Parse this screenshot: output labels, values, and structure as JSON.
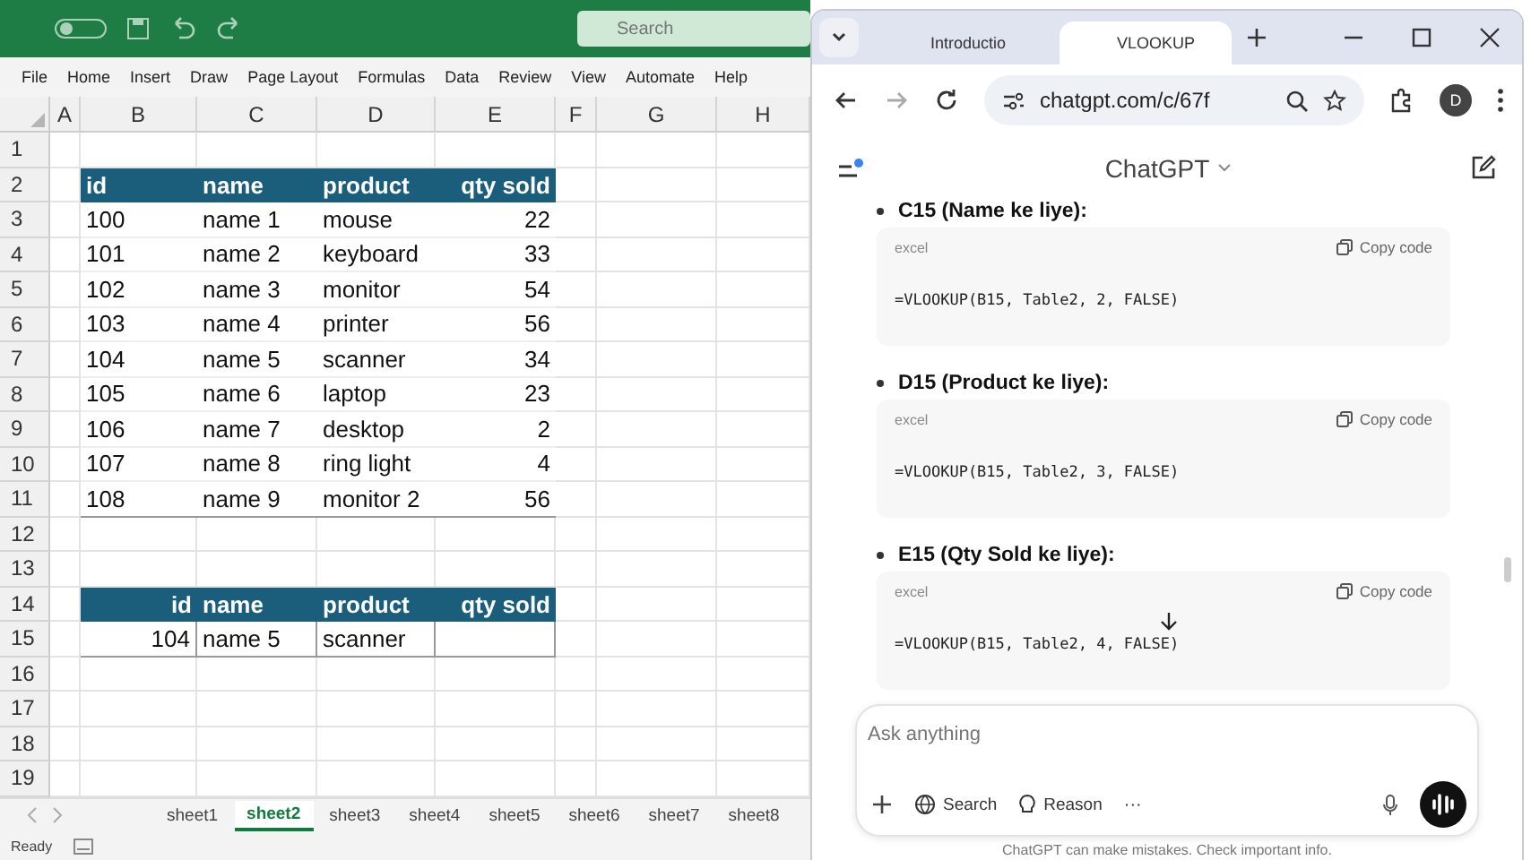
{
  "excel": {
    "search": {
      "placeholder": "Search"
    },
    "ribbon_tabs": [
      "File",
      "Home",
      "Insert",
      "Draw",
      "Page Layout",
      "Formulas",
      "Data",
      "Review",
      "View",
      "Automate",
      "Help"
    ],
    "column_headers": [
      "A",
      "B",
      "C",
      "D",
      "E",
      "F",
      "G",
      "H"
    ],
    "row_headers": [
      "1",
      "2",
      "3",
      "4",
      "5",
      "6",
      "7",
      "8",
      "9",
      "10",
      "11",
      "12",
      "13",
      "14",
      "15",
      "16",
      "17",
      "18",
      "19"
    ],
    "tables": [
      {
        "columns": [
          {
            "label": "id",
            "kind": "text"
          },
          {
            "label": "name",
            "kind": "text"
          },
          {
            "label": "product",
            "kind": "text"
          },
          {
            "label": "qty sold",
            "kind": "number"
          }
        ],
        "rows": [
          [
            "100",
            "name 1",
            "mouse",
            "22"
          ],
          [
            "101",
            "name 2",
            "keyboard",
            "33"
          ],
          [
            "102",
            "name 3",
            "monitor",
            "54"
          ],
          [
            "103",
            "name 4",
            "printer",
            "56"
          ],
          [
            "104",
            "name 5",
            "scanner",
            "34"
          ],
          [
            "105",
            "name 6",
            "laptop",
            "23"
          ],
          [
            "106",
            "name 7",
            "desktop",
            "2"
          ],
          [
            "107",
            "name 8",
            "ring light",
            "4"
          ],
          [
            "108",
            "name 9",
            "monitor 2",
            "56"
          ]
        ]
      },
      {
        "columns": [
          {
            "label": "id",
            "kind": "number"
          },
          {
            "label": "name",
            "kind": "text"
          },
          {
            "label": "product",
            "kind": "text"
          },
          {
            "label": "qty sold",
            "kind": "number"
          }
        ],
        "rows": [
          [
            "104",
            "name 5",
            "scanner"
          ]
        ]
      }
    ],
    "sheet_tabs": [
      {
        "label": "sheet1",
        "selected": false
      },
      {
        "label": "sheet2",
        "selected": true
      },
      {
        "label": "sheet3",
        "selected": false
      },
      {
        "label": "sheet4",
        "selected": false
      },
      {
        "label": "sheet5",
        "selected": false
      },
      {
        "label": "sheet6",
        "selected": false
      },
      {
        "label": "sheet7",
        "selected": false
      },
      {
        "label": "sheet8",
        "selected": false
      }
    ],
    "status": "Ready"
  },
  "browser": {
    "tabs": [
      {
        "title": "Introductio",
        "selected": false
      },
      {
        "title": "VLOOKUP",
        "selected": true
      }
    ],
    "address": "chatgpt.com/c/67f",
    "profile_initial": "D",
    "app_title": "ChatGPT",
    "sections": [
      {
        "heading": "C15 (Name ke liye):",
        "language": "excel",
        "copy_label": "Copy code",
        "code": "=VLOOKUP(B15, Table2, 2, FALSE)"
      },
      {
        "heading": "D15 (Product ke liye):",
        "language": "excel",
        "copy_label": "Copy code",
        "code": "=VLOOKUP(B15, Table2, 3, FALSE)"
      },
      {
        "heading": "E15 (Qty Sold ke liye):",
        "language": "excel",
        "copy_label": "Copy code",
        "code": "=VLOOKUP(B15, Table2, 4, FALSE)"
      }
    ],
    "composer": {
      "placeholder": "Ask anything",
      "tools": [
        "Search",
        "Reason"
      ],
      "more": "···"
    },
    "footer": "ChatGPT can make mistakes. Check important info."
  }
}
